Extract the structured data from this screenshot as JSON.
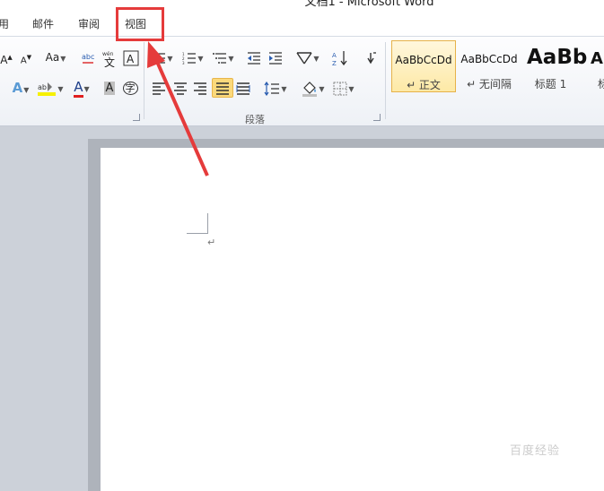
{
  "window": {
    "title": "文档1 - Microsoft Word"
  },
  "tabs": [
    "用",
    "邮件",
    "审阅",
    "视图"
  ],
  "ribbon": {
    "font_buttons": {
      "grow": "A",
      "shrink": "A",
      "case": "Aa",
      "clear": "A",
      "font_color": "A",
      "char_shade": "A",
      "enclose": "字"
    },
    "group_paragraph": "段落",
    "styles": [
      {
        "preview": "AaBbCcDd",
        "label": "↵ 正文"
      },
      {
        "preview": "AaBbCcDd",
        "label": "↵ 无间隔"
      },
      {
        "preview": "AaBb",
        "label": "标题 1"
      },
      {
        "preview": "A",
        "label": "标"
      }
    ]
  },
  "document": {
    "paragraph_mark": "↵"
  },
  "watermark": "百度经验",
  "colors": {
    "highlight_box": "#e53b3b",
    "accent": "#fbd97b"
  }
}
